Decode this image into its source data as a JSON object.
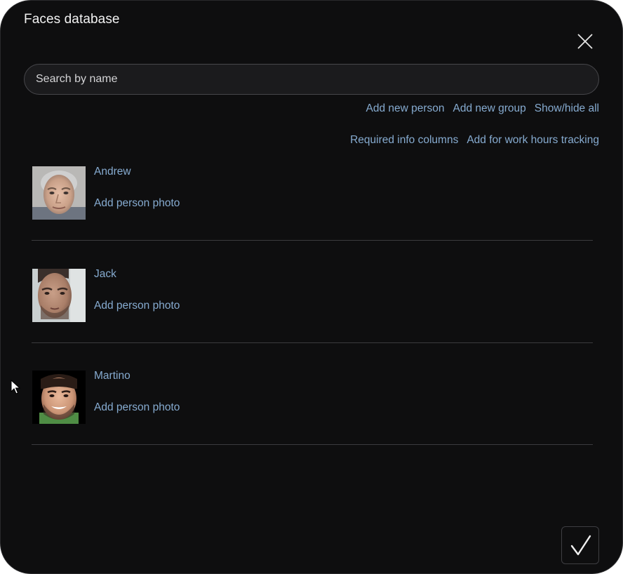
{
  "dialog": {
    "title": "Faces database"
  },
  "search": {
    "placeholder": "Search by name",
    "value": ""
  },
  "actions": {
    "add_new_person": "Add new person",
    "add_new_group": "Add new group",
    "show_hide_all": "Show/hide all",
    "required_info_columns": "Required info columns",
    "add_for_work_hours_tracking": "Add for work hours tracking"
  },
  "people": [
    {
      "name": "Andrew",
      "add_photo_label": "Add person photo"
    },
    {
      "name": "Jack",
      "add_photo_label": "Add person photo"
    },
    {
      "name": "Martino",
      "add_photo_label": "Add person photo"
    }
  ],
  "icons": {
    "close": "close-icon",
    "confirm": "checkmark-icon",
    "pointer": "mouse-cursor-icon"
  },
  "colors": {
    "background": "#0e0e0f",
    "link": "#86abd0",
    "text": "#f2f2f2",
    "divider": "#3b3b3e"
  }
}
